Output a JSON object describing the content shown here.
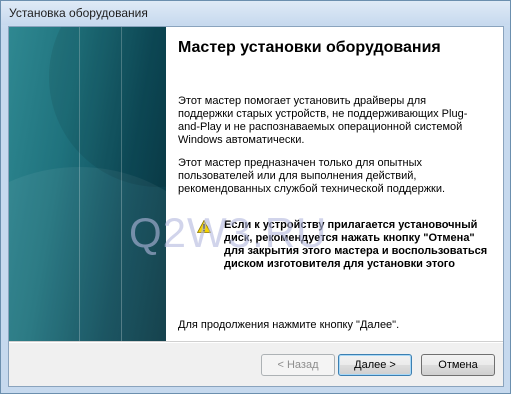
{
  "window": {
    "title": "Установка оборудования"
  },
  "content": {
    "heading": "Мастер установки оборудования",
    "paragraph1": "Этот мастер помогает установить драйверы для поддержки старых устройств, не поддерживающих Plug-and-Play и не распознаваемых операционной системой Windows автоматически.",
    "paragraph2": "Этот мастер предназначен только для опытных пользователей или для выполнения действий, рекомендованных службой технической поддержки.",
    "warning": "Если к устройству прилагается установочный диск, рекомендуется нажать кнопку \"Отмена\" для закрытия этого мастера и воспользоваться диском изготовителя для установки этого",
    "warning_icon": "warning-triangle-icon",
    "paragraph3": "Для продолжения нажмите кнопку \"Далее\".",
    "watermark": "Q2W3.RU"
  },
  "buttons": {
    "back": "< Назад",
    "next": "Далее >",
    "cancel": "Отмена"
  },
  "colors": {
    "banner_teal": "#1f727d",
    "warning_yellow": "#f5d400"
  }
}
